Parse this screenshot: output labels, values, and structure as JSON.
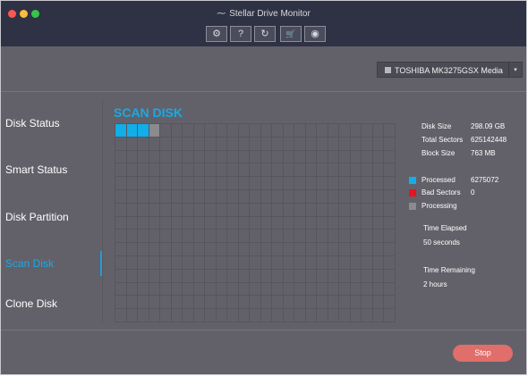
{
  "window": {
    "title": "Stellar Drive Monitor"
  },
  "toolbar": {
    "buttons": [
      {
        "icon": "gear-icon",
        "glyph": "⚙"
      },
      {
        "icon": "help-icon",
        "glyph": "?"
      },
      {
        "icon": "refresh-icon",
        "glyph": "↻"
      },
      {
        "icon": "cart-icon",
        "glyph": "🛒"
      },
      {
        "icon": "user-icon",
        "glyph": "◉"
      }
    ]
  },
  "drive": {
    "selected": "TOSHIBA MK3275GSX Media",
    "caret": "▾"
  },
  "sidebar": {
    "items": [
      {
        "label": "Disk Status"
      },
      {
        "label": "Smart Status"
      },
      {
        "label": "Disk Partition"
      },
      {
        "label": "Scan Disk",
        "active": true
      },
      {
        "label": "Clone Disk"
      }
    ]
  },
  "scan": {
    "title": "SCAN DISK",
    "grid": {
      "columns": 25,
      "rows": 15,
      "processed_blocks": 3,
      "processing_blocks": 1
    }
  },
  "details": {
    "disk_size_label": "Disk Size",
    "disk_size": "298.09 GB",
    "total_sectors_label": "Total Sectors",
    "total_sectors": "625142448",
    "block_size_label": "Block Size",
    "block_size": "763 MB"
  },
  "legend": {
    "processed_label": "Processed",
    "processed_value": "6275072",
    "processed_color": "#11aee9",
    "bad_label": "Bad Sectors",
    "bad_value": "0",
    "bad_color": "#e8131c",
    "processing_label": "Processing",
    "processing_color": "#8b8b8f"
  },
  "time": {
    "elapsed_label": "Time Elapsed",
    "elapsed": "50 seconds",
    "remaining_label": "Time Remaining",
    "remaining": "2 hours"
  },
  "actions": {
    "stop_label": "Stop"
  }
}
